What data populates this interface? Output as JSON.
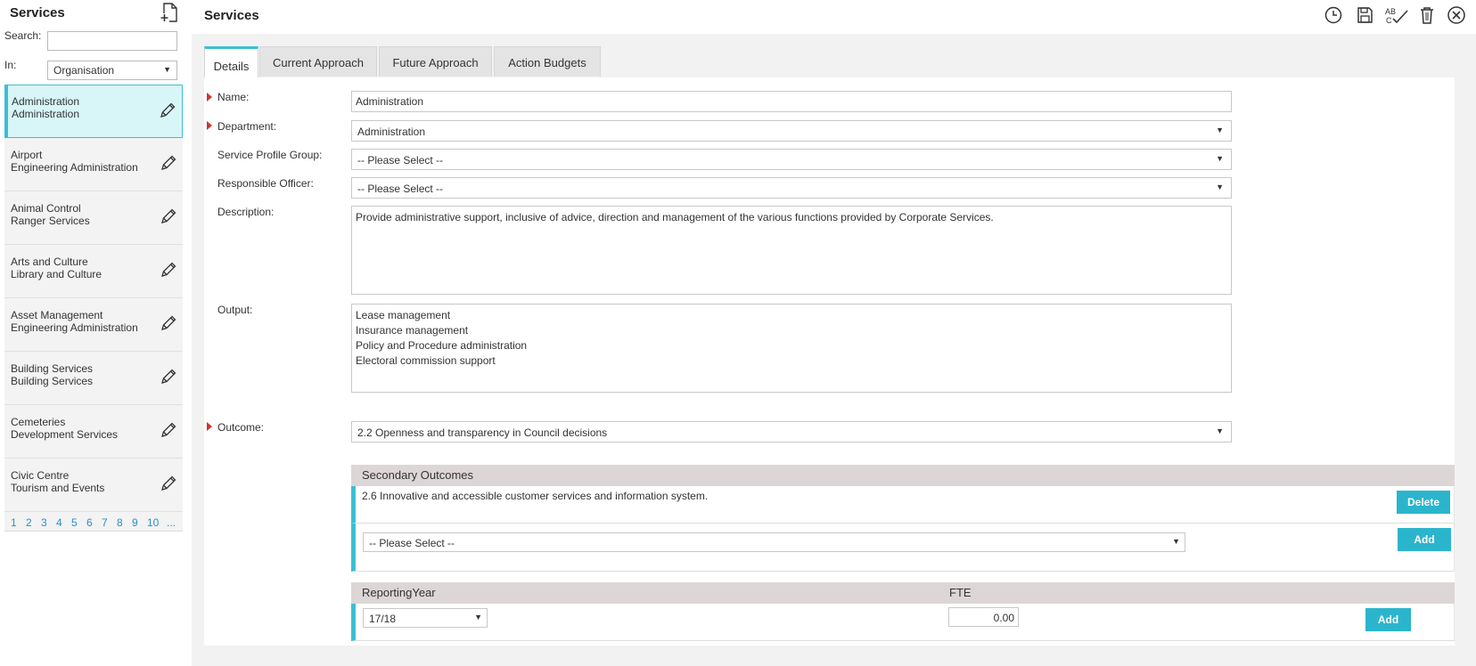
{
  "sidebar": {
    "title": "Services",
    "search_label": "Search:",
    "search_value": "",
    "in_label": "In:",
    "in_value": "Organisation",
    "items": [
      {
        "line1": "Administration",
        "line2": "Administration"
      },
      {
        "line1": "Airport",
        "line2": "Engineering Administration"
      },
      {
        "line1": "Animal Control",
        "line2": "Ranger Services"
      },
      {
        "line1": "Arts and Culture",
        "line2": "Library and Culture"
      },
      {
        "line1": "Asset Management",
        "line2": "Engineering Administration"
      },
      {
        "line1": "Building Services",
        "line2": "Building Services"
      },
      {
        "line1": "Cemeteries",
        "line2": "Development Services"
      },
      {
        "line1": "Civic Centre",
        "line2": "Tourism and Events"
      }
    ],
    "pages": [
      "1",
      "2",
      "3",
      "4",
      "5",
      "6",
      "7",
      "8",
      "9",
      "10",
      "..."
    ]
  },
  "header": {
    "title": "Services",
    "icons": [
      "history-icon",
      "save-icon",
      "spellcheck-icon",
      "delete-icon",
      "close-icon"
    ]
  },
  "tabs": [
    {
      "label": "Details"
    },
    {
      "label": "Current Approach"
    },
    {
      "label": "Future Approach"
    },
    {
      "label": "Action Budgets"
    }
  ],
  "form": {
    "name_label": "Name:",
    "name_value": "Administration",
    "department_label": "Department:",
    "department_value": "Administration",
    "profile_group_label": "Service Profile Group:",
    "profile_group_value": "-- Please Select --",
    "officer_label": "Responsible Officer:",
    "officer_value": "-- Please Select --",
    "description_label": "Description:",
    "description_value": "Provide administrative support, inclusive of advice, direction and management of the various functions provided by Corporate Services.",
    "output_label": "Output:",
    "output_lines": [
      "Lease management",
      "Insurance management",
      "Policy and Procedure administration",
      "Electoral commission support"
    ],
    "outcome_label": "Outcome:",
    "outcome_value": "2.2 Openness and transparency in Council decisions"
  },
  "secondary": {
    "header": "Secondary Outcomes",
    "row_text": "2.6 Innovative and accessible customer services and information system.",
    "delete_label": "Delete",
    "select_value": "-- Please Select --",
    "add_label": "Add"
  },
  "fte": {
    "year_header": "ReportingYear",
    "fte_header": "FTE",
    "year_value": "17/18",
    "fte_value": "0.00",
    "add_label": "Add"
  },
  "colors": {
    "accent": "#2bb5cc",
    "required": "#d0342c",
    "active_item": "#d8f6f8"
  }
}
